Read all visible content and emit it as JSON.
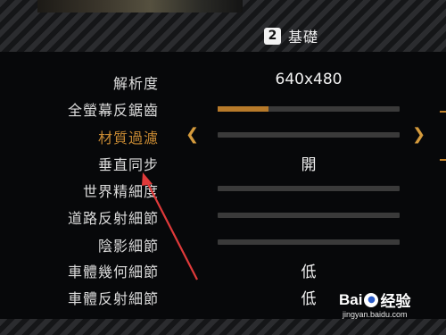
{
  "header": {
    "tab_number": "2",
    "tab_title": "基礎"
  },
  "settings": [
    {
      "label": "解析度",
      "value": "640x480",
      "control": "text",
      "selected": false
    },
    {
      "label": "全螢幕反鋸齒",
      "value": "",
      "control": "slider",
      "level": 0.28,
      "selected": false
    },
    {
      "label": "材質過濾",
      "value": "",
      "control": "slider",
      "level": 0,
      "selected": true
    },
    {
      "label": "垂直同步",
      "value": "開",
      "control": "text",
      "selected": false
    },
    {
      "label": "世界精細度",
      "value": "",
      "control": "slider",
      "level": 0,
      "selected": false
    },
    {
      "label": "道路反射細節",
      "value": "",
      "control": "slider",
      "level": 0,
      "selected": false
    },
    {
      "label": "陰影細節",
      "value": "",
      "control": "slider",
      "level": 0,
      "selected": false
    },
    {
      "label": "車體幾何細節",
      "value": "低",
      "control": "text",
      "selected": false
    },
    {
      "label": "車體反射細節",
      "value": "低",
      "control": "text",
      "selected": false
    }
  ],
  "arrows": {
    "left": "❮",
    "right": "❯"
  },
  "watermark": {
    "brand": "Bai",
    "brand2": "经验",
    "paw": "●",
    "url": "jingyan.baidu.com"
  },
  "colors": {
    "accent": "#c88a33",
    "slider_track": "#3a3a3a",
    "slider_fill": "#b77a2a",
    "annotation_arrow": "#e03a3a"
  }
}
